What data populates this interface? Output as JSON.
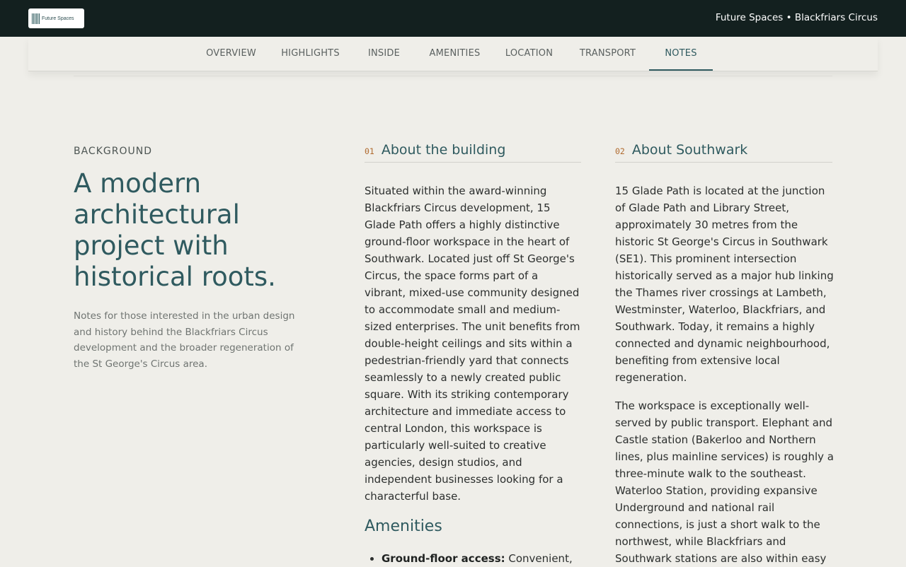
{
  "header": {
    "logo_text": "Future Spaces",
    "title": "Future Spaces • Blackfriars Circus"
  },
  "tabs": [
    {
      "label": "OVERVIEW",
      "active": false
    },
    {
      "label": "HIGHLIGHTS",
      "active": false
    },
    {
      "label": "INSIDE",
      "active": false
    },
    {
      "label": "AMENITIES",
      "active": false
    },
    {
      "label": "LOCATION",
      "active": false
    },
    {
      "label": "TRANSPORT",
      "active": false
    },
    {
      "label": "NOTES",
      "active": true
    }
  ],
  "background": {
    "eyebrow": "BACKGROUND",
    "heading": "A modern architectural project with historical roots.",
    "intro": "Notes for those interested in the urban design and history behind the Blackfriars Circus development and the broader regeneration of the St George's Circus area."
  },
  "building": {
    "number": "01",
    "title": "About the building",
    "body": "Situated within the award-winning Blackfriars Circus development, 15 Glade Path offers a highly distinctive ground-floor workspace in the heart of Southwark. Located just off St George's Circus, the space forms part of a vibrant, mixed-use community designed to accommodate small and medium-sized enterprises. The unit benefits from double-height ceilings and sits within a pedestrian-friendly yard that connects seamlessly to a newly created public square. With its striking contemporary architecture and immediate access to central London, this workspace is particularly well-suited to creative agencies, design studios, and independent businesses looking for a characterful base.",
    "amenities_heading": "Amenities",
    "amenities": [
      {
        "term": "Ground-floor access:",
        "text": " Convenient,"
      }
    ]
  },
  "southwark": {
    "number": "02",
    "title": "About Southwark",
    "body1": "15 Glade Path is located at the junction of Glade Path and Library Street, approximately 30 metres from the historic St George's Circus in Southwark (SE1). This prominent intersection historically served as a major hub linking the Thames river crossings at Lambeth, Westminster, Waterloo, Blackfriars, and Southwark. Today, it remains a highly connected and dynamic neighbourhood, benefiting from extensive local regeneration.",
    "body2": "The workspace is exceptionally well-served by public transport. Elephant and Castle station (Bakerloo and Northern lines, plus mainline services) is roughly a three-minute walk to the southeast. Waterloo Station, providing expansive Underground and national rail connections, is just a short walk to the northwest, while Blackfriars and Southwark stations are also within easy"
  }
}
